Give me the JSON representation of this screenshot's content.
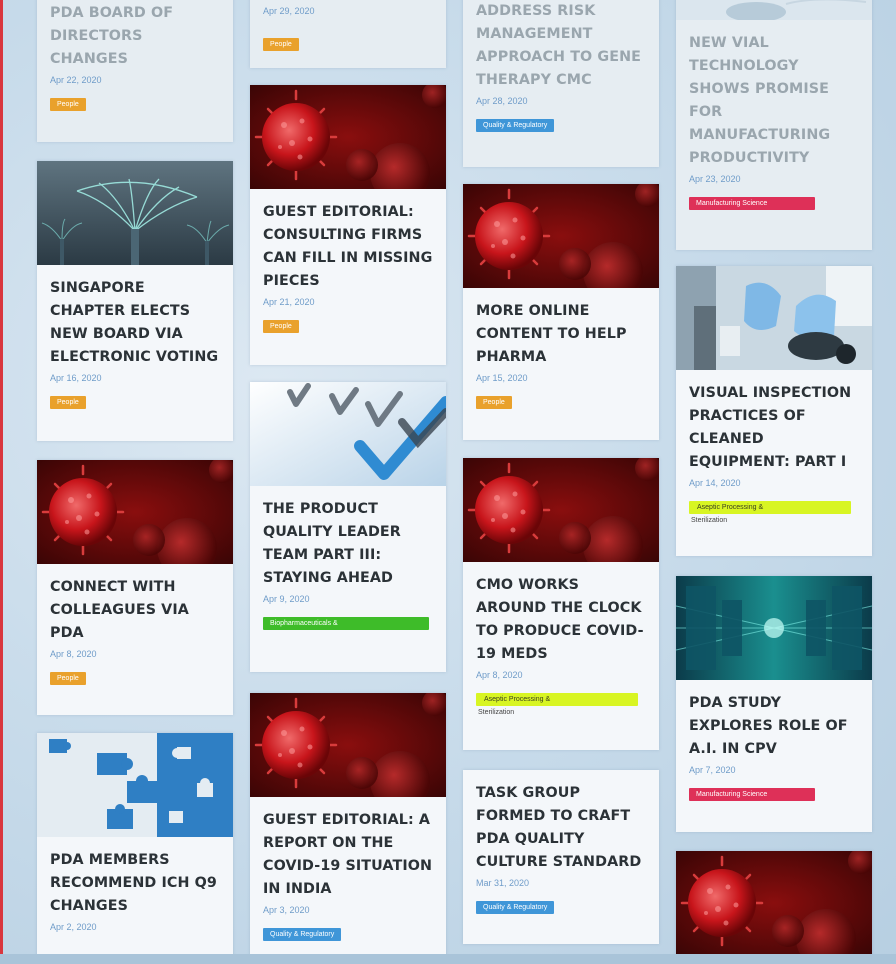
{
  "columns": [
    {
      "cards": [
        {
          "title": "PDA BOARD OF DIRECTORS CHANGES",
          "date": "Apr 22, 2020",
          "tag": "People"
        },
        {
          "title": "SINGAPORE CHAPTER ELECTS NEW BOARD VIA ELECTRONIC VOTING",
          "date": "Apr 16, 2020",
          "tag": "People",
          "image": "singapore-gardens-image"
        },
        {
          "title": "CONNECT WITH COLLEAGUES VIA PDA",
          "date": "Apr 8, 2020",
          "tag": "People",
          "image": "coronavirus-image"
        },
        {
          "title": "PDA MEMBERS RECOMMEND ICH Q9 CHANGES",
          "date": "Apr 2, 2020",
          "image": "puzzle-pieces-image"
        }
      ]
    },
    {
      "cards": [
        {
          "date": "Apr 29, 2020",
          "tag": "People"
        },
        {
          "title": "GUEST EDITORIAL: CONSULTING FIRMS CAN FILL IN MISSING PIECES",
          "date": "Apr 21, 2020",
          "tag": "People",
          "image": "coronavirus-image"
        },
        {
          "title": "THE PRODUCT QUALITY LEADER TEAM PART III: STAYING AHEAD",
          "date": "Apr 9, 2020",
          "tag": "Biopharmaceuticals &",
          "image": "checkmarks-image"
        },
        {
          "title": "GUEST EDITORIAL: A REPORT ON THE COVID-19 SITUATION IN INDIA",
          "date": "Apr 3, 2020",
          "tag": "Quality & Regulatory",
          "image": "coronavirus-image"
        }
      ]
    },
    {
      "cards": [
        {
          "title": "PDA COMMENTS ADDRESS RISK MANAGEMENT APPROACH TO GENE THERAPY CMC",
          "date": "Apr 28, 2020",
          "tag": "Quality & Regulatory"
        },
        {
          "title": "MORE ONLINE CONTENT TO HELP PHARMA",
          "date": "Apr 15, 2020",
          "tag": "People",
          "image": "coronavirus-image"
        },
        {
          "title": "CMO WORKS AROUND THE CLOCK TO PRODUCE COVID-19 MEDS",
          "date": "Apr 8, 2020",
          "tag": "Aseptic Processing &",
          "tag_sub": "Sterilization",
          "image": "coronavirus-image"
        },
        {
          "title": "TASK GROUP FORMED TO CRAFT PDA QUALITY CULTURE STANDARD",
          "date": "Mar 31, 2020",
          "tag": "Quality & Regulatory"
        }
      ]
    },
    {
      "cards": [
        {
          "title": "NEW VIAL TECHNOLOGY SHOWS PROMISE FOR MANUFACTURING PRODUCTIVITY",
          "date": "Apr 23, 2020",
          "tag": "Manufacturing Science",
          "image": "vial-image"
        },
        {
          "title": "VISUAL INSPECTION PRACTICES OF CLEANED EQUIPMENT: PART I",
          "date": "Apr 14, 2020",
          "tag": "Aseptic Processing &",
          "tag_sub": "Sterilization",
          "image": "lab-gloves-image"
        },
        {
          "title": "PDA STUDY EXPLORES ROLE OF A.I. IN CPV",
          "date": "Apr 7, 2020",
          "tag": "Manufacturing Science",
          "image": "data-center-image"
        },
        {
          "image": "coronavirus-image"
        }
      ]
    }
  ],
  "colors": {
    "people": "#e9a12c",
    "quality_regulatory": "#3f96d8",
    "manufacturing_science": "#de3058",
    "biopharmaceuticals": "#3ebc29",
    "aseptic": "#d8f523",
    "date": "#6f9cc9"
  }
}
